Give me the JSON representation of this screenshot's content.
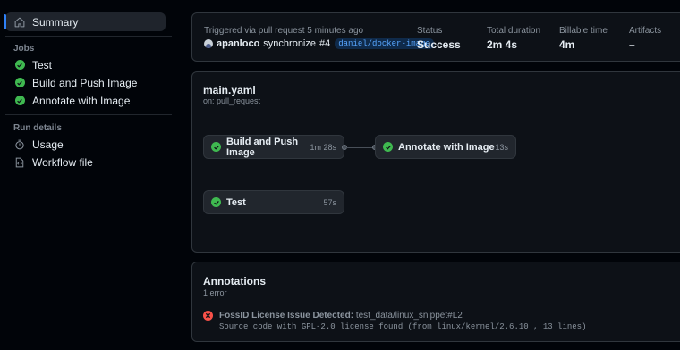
{
  "sidebar": {
    "summary_label": "Summary",
    "jobs_title": "Jobs",
    "jobs": [
      {
        "label": "Test"
      },
      {
        "label": "Build and Push Image"
      },
      {
        "label": "Annotate with Image"
      }
    ],
    "run_details_title": "Run details",
    "details": [
      {
        "label": "Usage"
      },
      {
        "label": "Workflow file"
      }
    ]
  },
  "summary": {
    "trigger_label": "Triggered via pull request 5 minutes ago",
    "actor": "apanloco",
    "action": "synchronize",
    "pr": "#4",
    "branch": "daniel/docker-image",
    "status_label": "Status",
    "status_value": "Success",
    "duration_label": "Total duration",
    "duration_value": "2m 4s",
    "billable_label": "Billable time",
    "billable_value": "4m",
    "artifacts_label": "Artifacts",
    "artifacts_value": "–"
  },
  "workflow": {
    "file": "main.yaml",
    "trigger": "on: pull_request",
    "jobs": [
      {
        "name": "Build and Push Image",
        "duration": "1m 28s"
      },
      {
        "name": "Annotate with Image",
        "duration": "13s"
      },
      {
        "name": "Test",
        "duration": "57s"
      }
    ]
  },
  "annotations": {
    "title": "Annotations",
    "count": "1 error",
    "item": {
      "title": "FossID License Issue Detected:",
      "location": "test_data/linux_snippet#L2",
      "detail": "Source code with GPL-2.0 license found (from linux/kernel/2.6.10 , 13 lines)"
    }
  },
  "colors": {
    "success": "#3fb950",
    "error": "#f85149",
    "accent": "#2f81f7"
  }
}
